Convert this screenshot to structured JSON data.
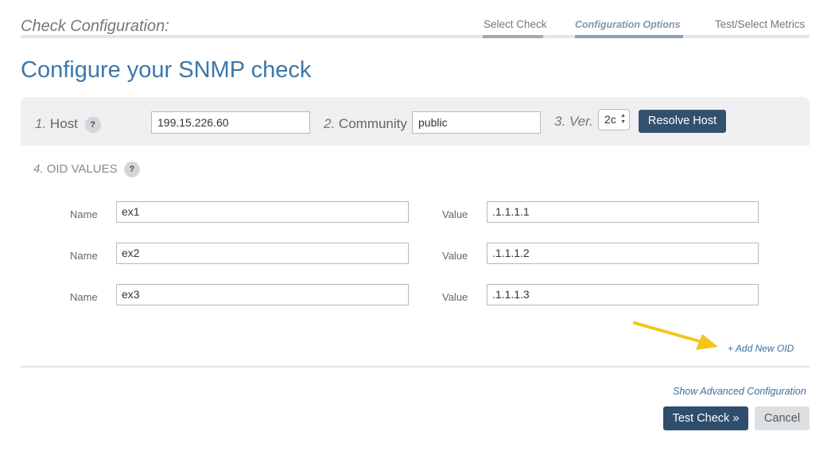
{
  "header": {
    "title": "Check Configuration:",
    "steps": [
      {
        "label": "Select Check",
        "state": "done",
        "color": "#a8a8a8"
      },
      {
        "label": "Configuration Options",
        "state": "active",
        "color": "#8aa2b9"
      },
      {
        "label": "Test/Select Metrics",
        "state": "pending",
        "color": "#e6e6e6"
      }
    ]
  },
  "page_title": "Configure your SNMP check",
  "host_bar": {
    "host_num": "1.",
    "host_label": "Host",
    "host_value": "199.15.226.60",
    "community_num": "2.",
    "community_label": "Community",
    "community_value": "public",
    "ver_num": "3.",
    "ver_label": "Ver.",
    "ver_value": "2c",
    "resolve_button": "Resolve Host",
    "help_icon": "?"
  },
  "oid": {
    "num": "4.",
    "title": "OID VALUES",
    "help_icon": "?",
    "name_label": "Name",
    "value_label": "Value",
    "rows": [
      {
        "name": "ex1",
        "value": ".1.1.1.1"
      },
      {
        "name": "ex2",
        "value": ".1.1.1.2"
      },
      {
        "name": "ex3",
        "value": ".1.1.1.3"
      }
    ],
    "add_link": "+ Add New OID"
  },
  "footer": {
    "advanced_link": "Show Advanced Configuration",
    "test_button": "Test Check »",
    "cancel_button": "Cancel"
  },
  "colors": {
    "accent": "#3c77aa",
    "primary_button": "#34506f",
    "annotation_arrow": "#f5c518"
  }
}
